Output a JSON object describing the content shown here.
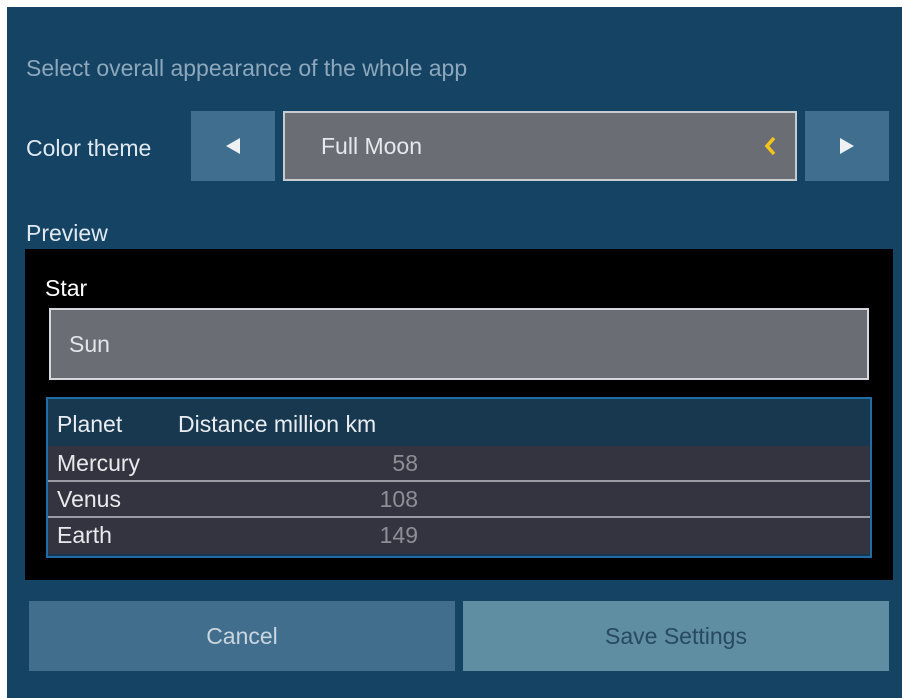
{
  "settings": {
    "subtitle": "Select overall appearance of the whole app",
    "theme_label": "Color theme",
    "theme_value": "Full Moon",
    "prev_icon": "triangle-left",
    "next_icon": "triangle-right",
    "field_indicator_icon": "chevron-left",
    "indicator_color": "#f5c518"
  },
  "preview": {
    "label": "Preview",
    "star_label": "Star",
    "star_value": "Sun",
    "table": {
      "headers": [
        "Planet",
        "Distance million km"
      ],
      "rows": [
        {
          "planet": "Mercury",
          "distance": "58"
        },
        {
          "planet": "Venus",
          "distance": "108"
        },
        {
          "planet": "Earth",
          "distance": "149"
        }
      ]
    }
  },
  "actions": {
    "cancel_label": "Cancel",
    "save_label": "Save Settings"
  },
  "colors": {
    "background": "#144364",
    "button": "#406e8f",
    "save_button": "#5f8da1",
    "field": "#6a6d74",
    "preview_bg": "#000000",
    "table_border": "#1f6da6"
  }
}
